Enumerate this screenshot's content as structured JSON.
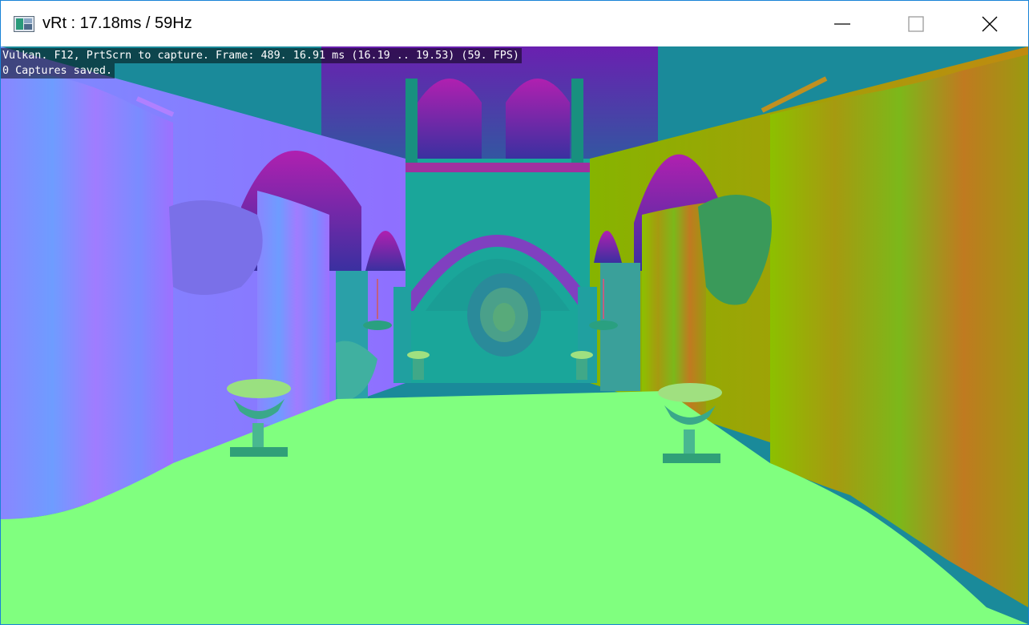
{
  "window": {
    "title": "vRt : 17.18ms / 59Hz",
    "icons": {
      "app": "application-icon",
      "minimize": "minimize-icon",
      "maximize": "maximize-icon",
      "close": "close-icon"
    },
    "border_color": "#1883d7"
  },
  "overlay": {
    "line1": "Vulkan. F12, PrtScrn to capture. Frame: 489. 16.91 ms (16.19 .. 19.53) (59. FPS)",
    "line2": "0 Captures saved."
  },
  "scene": {
    "description_colors": {
      "floor": "#80ff7f",
      "left_wall": "#8a7cff",
      "right_wall": "#9aa000",
      "back_wall": "#1aa69a"
    }
  }
}
